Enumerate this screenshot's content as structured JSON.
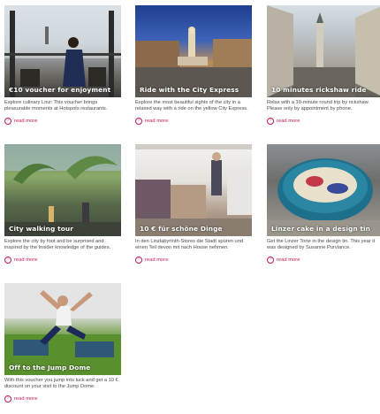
{
  "cards": [
    {
      "title": "€10 voucher for enjoyment",
      "description": "Explore culinary Linz: This voucher brings pleasurable moments at Hotspots restaurants.",
      "read_more": "read more"
    },
    {
      "title": "Ride with the City Express",
      "description": "Explore the most beautiful sights of the city in a relaxed way with a ride on the yellow City Express.",
      "read_more": "read more"
    },
    {
      "title": "10 minutes rickshaw ride",
      "description": "Relax with a 10-minute round trip by rickshaw. Please only by appointment by phone.",
      "read_more": "read more"
    },
    {
      "title": "City walking tour",
      "description": "Explore the city by foot and be surprised and inspired by the Insider knowledge of the guides.",
      "read_more": "read more"
    },
    {
      "title": "10 € für schöne Dinge",
      "description": "In den LinzlabyrInth-Stores die Stadt spüren und einen Teil devon mit nach House nehmen.",
      "read_more": "read more"
    },
    {
      "title": "Linzer cake in a design tin",
      "description": "Get the Linzer Torte in the design tin. This year it was designed by Susanne Purviance.",
      "read_more": "read more"
    },
    {
      "title": "Off to the Jump Dome",
      "description": "With this voucher you jump into luck and get a 10 € discount on your visit to the Jump Dome.",
      "read_more": "read more"
    }
  ],
  "colors": {
    "accent": "#c2185b",
    "text": "#4a4a4a"
  },
  "icons": {
    "read_more": "chevron-right-circle-icon"
  }
}
